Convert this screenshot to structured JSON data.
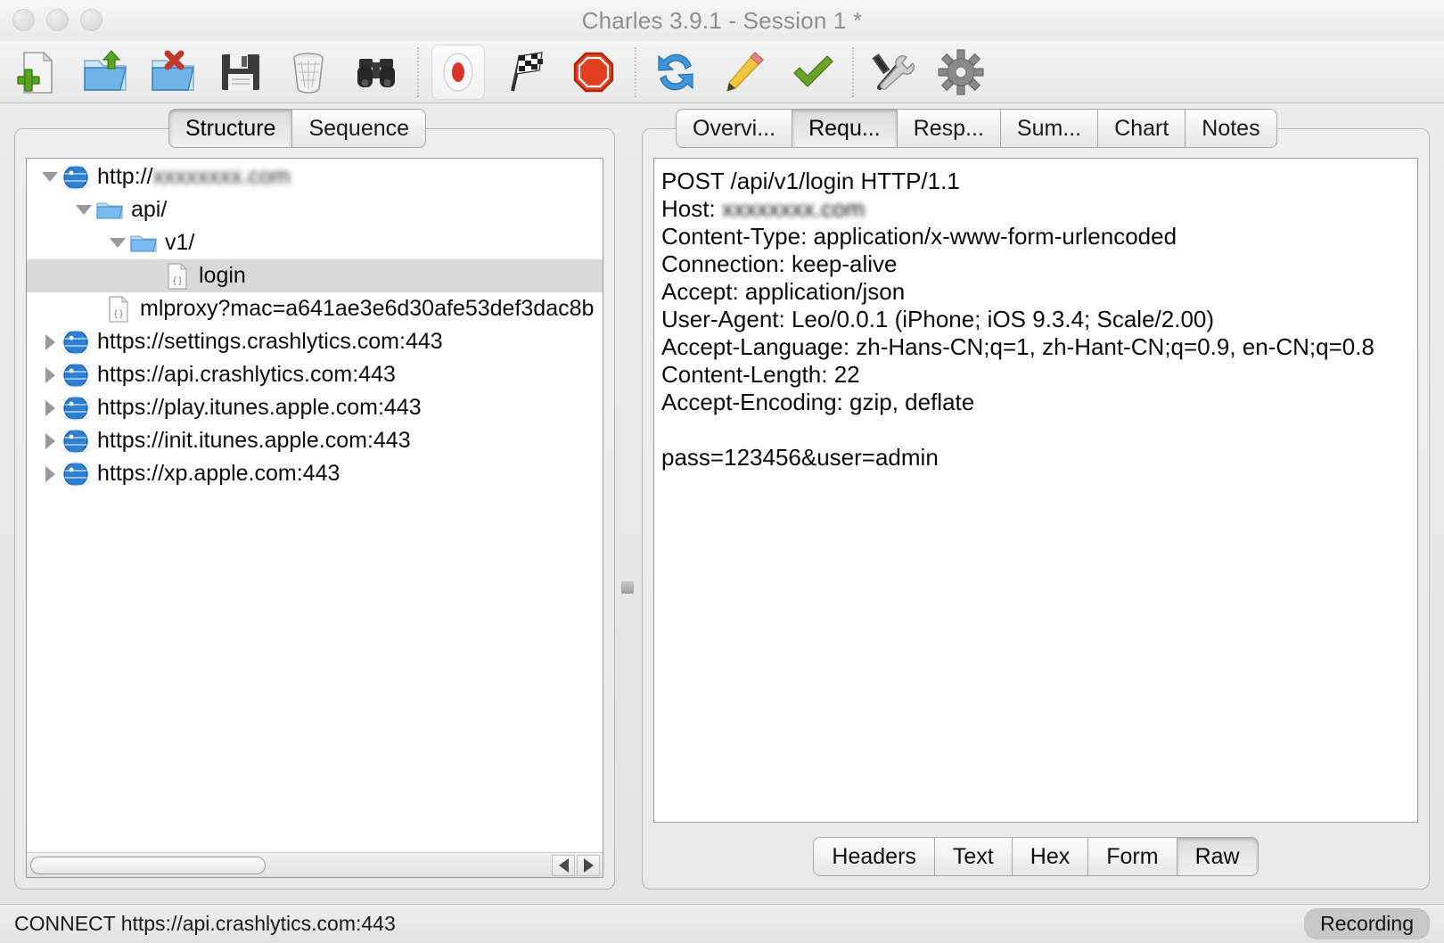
{
  "window": {
    "title": "Charles 3.9.1 - Session 1 *",
    "traffic_lights": [
      "close-button",
      "minimize-button",
      "zoom-button"
    ]
  },
  "toolbar": {
    "buttons": [
      {
        "name": "new-session-icon",
        "label": "New Session"
      },
      {
        "name": "open-folder-icon",
        "label": "Open"
      },
      {
        "name": "close-folder-icon",
        "label": "Close"
      },
      {
        "name": "save-floppy-icon",
        "label": "Save Session"
      },
      {
        "name": "trash-icon",
        "label": "Clear Session"
      },
      {
        "name": "binoculars-icon",
        "label": "Find"
      },
      {
        "name": "record-icon",
        "label": "Start/Stop Recording",
        "framed": true
      },
      {
        "name": "checkered-flag-icon",
        "label": "Start/Stop Throttling"
      },
      {
        "name": "stop-sign-icon",
        "label": "Breakpoints"
      },
      {
        "name": "repeat-refresh-icon",
        "label": "Repeat"
      },
      {
        "name": "pencil-edit-icon",
        "label": "Compose"
      },
      {
        "name": "green-check-icon",
        "label": "Validate"
      },
      {
        "name": "tools-icon",
        "label": "Tools"
      },
      {
        "name": "gear-icon",
        "label": "Settings"
      }
    ]
  },
  "left_panel": {
    "tabs": [
      {
        "label": "Structure",
        "active": true
      },
      {
        "label": "Sequence",
        "active": false
      }
    ],
    "tree": [
      {
        "indent": 0,
        "twisty": "down",
        "icon": "globe-icon",
        "label": "http://",
        "blurred_suffix": "xxxxxxxx.com",
        "selected": false
      },
      {
        "indent": 1,
        "twisty": "down",
        "icon": "folder-icon",
        "label": "api/",
        "selected": false
      },
      {
        "indent": 2,
        "twisty": "down",
        "icon": "folder-icon",
        "label": "v1/",
        "selected": false
      },
      {
        "indent": 3,
        "twisty": "none",
        "icon": "json-file-icon",
        "label": "login",
        "selected": true
      },
      {
        "indent": 2,
        "twisty": "none",
        "icon": "json-file-icon",
        "label": "mlproxy?mac=a641ae3e6d30afe53def3dac8b",
        "selected": false
      },
      {
        "indent": 0,
        "twisty": "right",
        "icon": "globe-icon",
        "label": "https://settings.crashlytics.com:443",
        "selected": false
      },
      {
        "indent": 0,
        "twisty": "right",
        "icon": "globe-icon",
        "label": "https://api.crashlytics.com:443",
        "selected": false
      },
      {
        "indent": 0,
        "twisty": "right",
        "icon": "globe-icon",
        "label": "https://play.itunes.apple.com:443",
        "selected": false
      },
      {
        "indent": 0,
        "twisty": "right",
        "icon": "globe-icon",
        "label": "https://init.itunes.apple.com:443",
        "selected": false
      },
      {
        "indent": 0,
        "twisty": "right",
        "icon": "globe-icon",
        "label": "https://xp.apple.com:443",
        "selected": false
      }
    ]
  },
  "right_panel": {
    "tabs": [
      {
        "label": "Overvi...",
        "active": false
      },
      {
        "label": "Requ...",
        "active": true
      },
      {
        "label": "Resp...",
        "active": false
      },
      {
        "label": "Sum...",
        "active": false
      },
      {
        "label": "Chart",
        "active": false
      },
      {
        "label": "Notes",
        "active": false
      }
    ],
    "request": {
      "line_1": "POST /api/v1/login HTTP/1.1",
      "host_label": "Host: ",
      "host_value": "xxxxxxxx.com",
      "rest": "Content-Type: application/x-www-form-urlencoded\nConnection: keep-alive\nAccept: application/json\nUser-Agent: Leo/0.0.1 (iPhone; iOS 9.3.4; Scale/2.00)\nAccept-Language: zh-Hans-CN;q=1, zh-Hant-CN;q=0.9, en-CN;q=0.8\nContent-Length: 22\nAccept-Encoding: gzip, deflate\n\npass=123456&user=admin"
    },
    "bottom_tabs": [
      {
        "label": "Headers",
        "active": false
      },
      {
        "label": "Text",
        "active": false
      },
      {
        "label": "Hex",
        "active": false
      },
      {
        "label": "Form",
        "active": false
      },
      {
        "label": "Raw",
        "active": true
      }
    ]
  },
  "status_bar": {
    "text": "CONNECT https://api.crashlytics.com:443",
    "badge": "Recording"
  },
  "colors": {
    "accent_blue": "#2f7fd0",
    "record_red": "#d9342b",
    "folder_blue": "#6ab0e8",
    "check_green": "#6aa329",
    "window_bg": "#ececec",
    "selection_gray": "#d9d9d9"
  }
}
